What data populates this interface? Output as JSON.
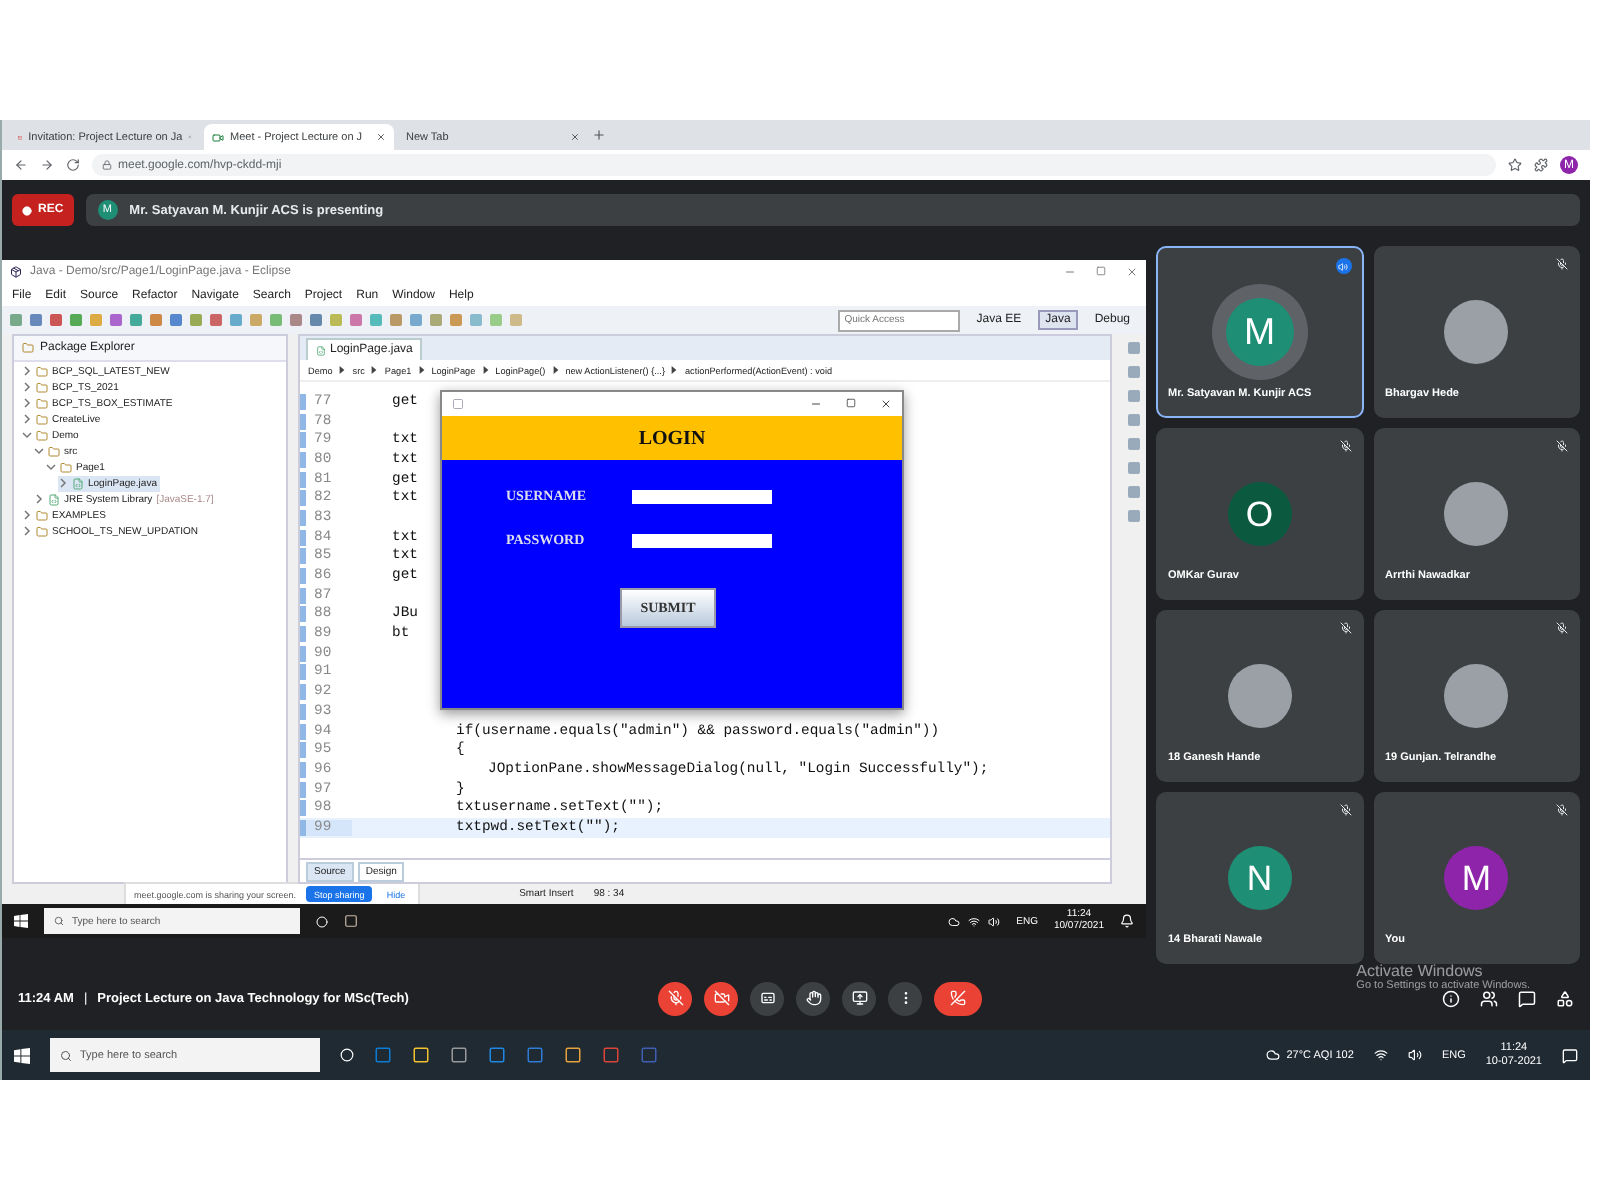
{
  "browser": {
    "tabs": [
      {
        "label": "Invitation: Project Lecture on Ja",
        "kind": "mail",
        "selected": false
      },
      {
        "label": "Meet - Project Lecture on J",
        "kind": "meet",
        "selected": true
      },
      {
        "label": "New Tab",
        "kind": "blank",
        "selected": false
      }
    ],
    "url": "meet.google.com/hvp-ckdd-mji",
    "profile": "M"
  },
  "meet": {
    "rec": "REC",
    "presenter_initial": "M",
    "presenting": "Mr. Satyavan M. Kunjir ACS is presenting"
  },
  "eclipse": {
    "title": "Java - Demo/src/Page1/LoginPage.java - Eclipse",
    "menu": [
      "File",
      "Edit",
      "Source",
      "Refactor",
      "Navigate",
      "Search",
      "Project",
      "Run",
      "Window",
      "Help"
    ],
    "quick_access": {
      "placeholder": "Quick Access"
    },
    "perspectives": [
      {
        "label": "Java EE",
        "selected": false
      },
      {
        "label": "Java",
        "selected": true
      },
      {
        "label": "Debug",
        "selected": false
      }
    ],
    "explorer": {
      "title": "Package Explorer",
      "tree": [
        {
          "label": "BCP_SQL_LATEST_NEW",
          "expanded": false,
          "selected": false
        },
        {
          "label": "BCP_TS_2021",
          "expanded": false,
          "selected": false
        },
        {
          "label": "BCP_TS_BOX_ESTIMATE",
          "expanded": false,
          "selected": false
        },
        {
          "label": "CreateLive",
          "expanded": false,
          "selected": false
        },
        {
          "label": "Demo",
          "expanded": true,
          "selected": false,
          "children": [
            {
              "label": "src",
              "expanded": true,
              "selected": false,
              "children": [
                {
                  "label": "Page1",
                  "expanded": true,
                  "selected": false,
                  "children": [
                    {
                      "label": "LoginPage.java",
                      "expanded": false,
                      "selected": true
                    }
                  ]
                }
              ]
            },
            {
              "label": "JRE System Library",
              "note": "[JavaSE-1.7]",
              "expanded": false,
              "selected": false
            }
          ]
        },
        {
          "label": "EXAMPLES",
          "expanded": false,
          "selected": false
        },
        {
          "label": "SCHOOL_TS_NEW_UPDATION",
          "expanded": false,
          "selected": false
        }
      ]
    },
    "editor": {
      "tab": "LoginPage.java",
      "breadcrumb": [
        "Demo",
        "src",
        "Page1",
        "LoginPage",
        "LoginPage()",
        "new ActionListener() {...}",
        "actionPerformed(ActionEvent) : void"
      ],
      "lines": [
        {
          "number": "77",
          "text": "get",
          "kind": "member",
          "current": false
        },
        {
          "number": "78",
          "current": false
        },
        {
          "number": "79",
          "text": "txt",
          "kind": "member",
          "current": false
        },
        {
          "number": "80",
          "text": "txt",
          "kind": "member",
          "current": false
        },
        {
          "number": "81",
          "text": "get",
          "kind": "member",
          "current": false
        },
        {
          "number": "82",
          "text": "txt",
          "kind": "member",
          "current": false
        },
        {
          "number": "83",
          "current": false
        },
        {
          "number": "84",
          "text": "txt",
          "kind": "member",
          "current": false
        },
        {
          "number": "85",
          "text": "txt",
          "kind": "member",
          "current": false
        },
        {
          "number": "86",
          "text": "get",
          "kind": "member",
          "current": false
        },
        {
          "number": "87",
          "current": false
        },
        {
          "number": "88",
          "text": "JBu",
          "kind": "member",
          "current": false
        },
        {
          "number": "89",
          "text": "bt",
          "kind": "member",
          "current": false
        },
        {
          "number": "90",
          "current": false
        },
        {
          "number": "91",
          "current": false
        },
        {
          "number": "92",
          "current": false
        },
        {
          "number": "93",
          "current": false
        },
        {
          "number": "94",
          "text": "if(username.equals(\"admin\") && password.equals(\"admin\"))",
          "kind": "block",
          "current": false
        },
        {
          "number": "95",
          "text": "{",
          "kind": "block",
          "current": false
        },
        {
          "number": "96",
          "text": "JOptionPane.showMessageDialog(null, \"Login Successfully\");",
          "kind": "inner",
          "current": false
        },
        {
          "number": "97",
          "text": "}",
          "kind": "block",
          "current": false
        },
        {
          "number": "98",
          "text": "txtusername.setText(\"\");",
          "kind": "block",
          "current": false
        },
        {
          "number": "99",
          "text": "txtpwd.setText(\"\");",
          "kind": "block",
          "current": true
        }
      ],
      "bottom_tabs": [
        {
          "label": "Source",
          "selected": true
        },
        {
          "label": "Design",
          "selected": false
        }
      ]
    },
    "share_bar": {
      "message": "meet.google.com is sharing your screen.",
      "stop": "Stop sharing",
      "hide": "Hide"
    },
    "status": [
      "Smart Insert",
      "98 : 34"
    ]
  },
  "login_dialog": {
    "title": "LOGIN",
    "fields": [
      {
        "label": "USERNAME"
      },
      {
        "label": "PASSWORD"
      }
    ],
    "button": "SUBMIT"
  },
  "inner_taskbar": {
    "search": "Type here to search",
    "lang": "ENG",
    "time": "11:24",
    "date": "10/07/2021"
  },
  "participants": [
    {
      "name": "Mr. Satyavan M. Kunjir ACS",
      "kind": "avatar",
      "initial": "M",
      "color": "#1e8e75",
      "speaking": true
    },
    {
      "name": "Bhargav Hede",
      "kind": "photo",
      "speaking": false
    },
    {
      "name": "OMKar Gurav",
      "kind": "avatar",
      "initial": "O",
      "color": "#0b5a3f",
      "speaking": false
    },
    {
      "name": "Arrthi Nawadkar",
      "kind": "photo",
      "speaking": false
    },
    {
      "name": "18 Ganesh Hande",
      "kind": "photo",
      "speaking": false
    },
    {
      "name": "19 Gunjan. Telrandhe",
      "kind": "photo",
      "speaking": false
    },
    {
      "name": "14 Bharati Nawale",
      "kind": "avatar",
      "initial": "N",
      "color": "#1e8e75",
      "speaking": false
    },
    {
      "name": "You",
      "kind": "avatar",
      "initial": "M",
      "color": "#8e24aa",
      "speaking": false
    }
  ],
  "bottom_bar": {
    "time": "11:24 AM",
    "separator": "|",
    "title": "Project Lecture on Java Technology for MSc(Tech)"
  },
  "activation": {
    "title": "Activate Windows",
    "hint": "Go to Settings to activate Windows."
  },
  "taskbar": {
    "search": "Type here to search",
    "weather": "27°C  AQI 102",
    "lang": "ENG",
    "time": "11:24",
    "date": "10-07-2021"
  }
}
